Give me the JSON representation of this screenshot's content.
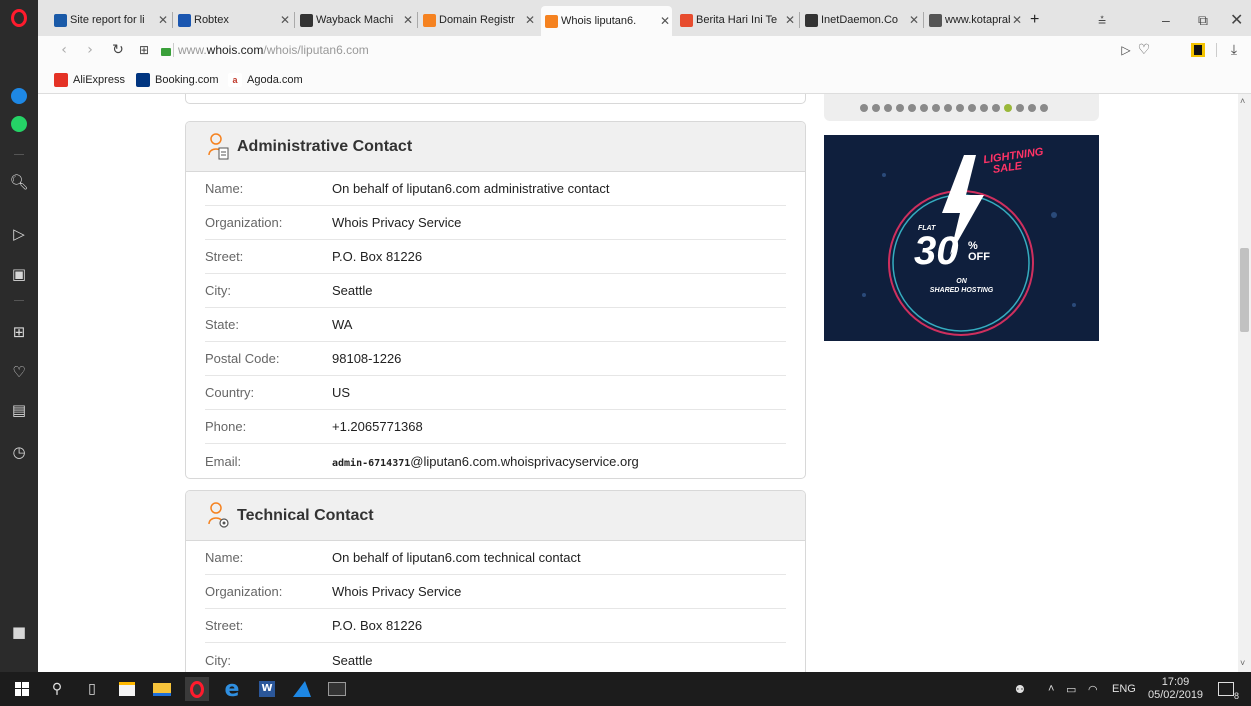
{
  "browser": {
    "tabs": [
      {
        "title": "Site report for li",
        "icon": "netcraft-icon",
        "color": "#1a5aa8",
        "active": false
      },
      {
        "title": "Robtex",
        "icon": "robtex-icon",
        "color": "#1a56b0",
        "active": false
      },
      {
        "title": "Wayback Machi",
        "icon": "wayback-icon",
        "color": "#333333",
        "active": false
      },
      {
        "title": "Domain Registr",
        "icon": "whois-icon",
        "color": "#f58220",
        "active": false
      },
      {
        "title": "Whois liputan6.",
        "icon": "whois-icon",
        "color": "#f58220",
        "active": true
      },
      {
        "title": "Berita Hari Ini Te",
        "icon": "liputan6-icon",
        "color": "#e74c2e",
        "active": false
      },
      {
        "title": "InetDaemon.Co",
        "icon": "inetdaemon-icon",
        "color": "#333333",
        "active": false
      },
      {
        "title": "www.kotaprabu",
        "icon": "page-icon",
        "color": "#555555",
        "active": false
      }
    ],
    "new_tab": "+",
    "url_prefix": "www.",
    "url_domain": "whois.com",
    "url_path": "/whois/liputan6.com",
    "bookmarks": [
      {
        "label": "AliExpress",
        "icon": "aliexpress-icon",
        "color": "#e43225"
      },
      {
        "label": "Booking.com",
        "icon": "booking-icon",
        "color": "#003580"
      },
      {
        "label": "Agoda.com",
        "icon": "agoda-icon",
        "color": "#ffffff"
      }
    ]
  },
  "admin_contact": {
    "title": "Administrative Contact",
    "rows": [
      {
        "label": "Name:",
        "value": "On behalf of liputan6.com administrative contact"
      },
      {
        "label": "Organization:",
        "value": "Whois Privacy Service"
      },
      {
        "label": "Street:",
        "value": "P.O. Box 81226"
      },
      {
        "label": "City:",
        "value": "Seattle"
      },
      {
        "label": "State:",
        "value": "WA"
      },
      {
        "label": "Postal Code:",
        "value": "98108-1226"
      },
      {
        "label": "Country:",
        "value": "US"
      },
      {
        "label": "Phone:",
        "value": "+1.2065771368"
      },
      {
        "label": "Email:",
        "value_prefix": "admin-6714371",
        "value": "@liputan6.com.whoisprivacyservice.org"
      }
    ]
  },
  "technical_contact": {
    "title": "Technical Contact",
    "rows": [
      {
        "label": "Name:",
        "value": "On behalf of liputan6.com technical contact"
      },
      {
        "label": "Organization:",
        "value": "Whois Privacy Service"
      },
      {
        "label": "Street:",
        "value": "P.O. Box 81226"
      },
      {
        "label": "City:",
        "value": "Seattle"
      }
    ]
  },
  "ad": {
    "headline_1": "LIGHTNING",
    "headline_2": "SALE",
    "flat": "FLAT",
    "big": "30",
    "pct": "%",
    "off": "OFF",
    "on": "ON",
    "sub": "SHARED HOSTING",
    "carousel_dots": 16,
    "carousel_active": 12
  },
  "taskbar": {
    "lang": "ENG",
    "time": "17:09",
    "date": "05/02/2019",
    "notif_count": "8"
  },
  "colors": {
    "accent_orange": "#f58220",
    "ad_bg": "#0f1f3d",
    "ad_pink": "#ff3366",
    "ad_cyan": "#3fd0e0"
  }
}
